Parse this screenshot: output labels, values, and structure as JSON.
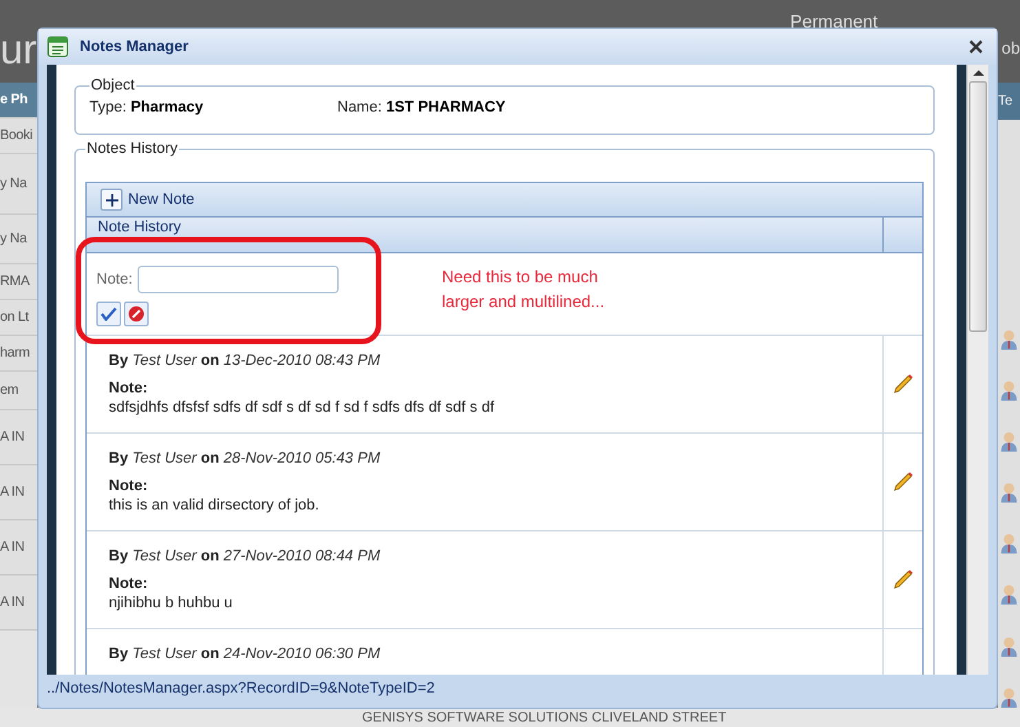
{
  "background": {
    "logo_text": "ur",
    "top_label": "Permanent",
    "right_texts": [
      "ob",
      "Te"
    ],
    "left_cells": [
      "e Ph",
      "Booki",
      "y Na",
      "y Na",
      "RMA",
      "on Lt",
      "harm",
      "em",
      "A IN",
      "A IN",
      "A IN",
      "A IN"
    ],
    "bottom_cell": "GENISYS SOFTWARE SOLUTIONS CLIVELAND STREET"
  },
  "dialog": {
    "title": "Notes Manager",
    "object": {
      "legend": "Object",
      "fields": [
        {
          "label": "Type:",
          "value": "Pharmacy"
        },
        {
          "label": "Name:",
          "value": "1ST PHARMACY"
        }
      ]
    },
    "history": {
      "legend": "Notes History",
      "new_note_button": "New Note",
      "grid_header": "Note History",
      "form": {
        "label": "Note:"
      },
      "notes": [
        {
          "by": "By",
          "user": "Test User",
          "on": "on",
          "date": "13-Dec-2010 08:43 PM",
          "note_label": "Note:",
          "text": "sdfsjdhfs dfsfsf sdfs df sdf s df sd f sd f sdfs dfs df sdf s df"
        },
        {
          "by": "By",
          "user": "Test User",
          "on": "on",
          "date": "28-Nov-2010 05:43 PM",
          "note_label": "Note:",
          "text": "this is an valid dirsectory of job."
        },
        {
          "by": "By",
          "user": "Test User",
          "on": "on",
          "date": "27-Nov-2010 08:44 PM",
          "note_label": "Note:",
          "text": "njihibhu b huhbu u"
        },
        {
          "by": "By",
          "user": "Test User",
          "on": "on",
          "date": "24-Nov-2010 06:30 PM"
        }
      ]
    },
    "status_bar": "../Notes/NotesManager.aspx?RecordID=9&NoteTypeID=2"
  },
  "annotation": {
    "lines": [
      "Need this to be much",
      "larger and multilined..."
    ]
  }
}
